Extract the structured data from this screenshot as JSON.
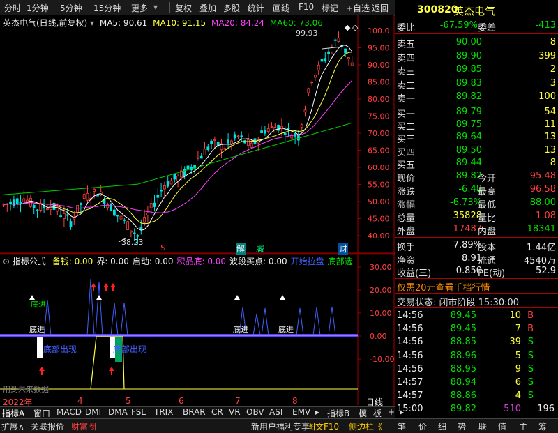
{
  "toolbar": {
    "periods": [
      "分时",
      "1分钟",
      "5分钟",
      "15分钟",
      "更多"
    ],
    "actions": [
      "复权",
      "叠加",
      "多股",
      "统计",
      "画线",
      "F10",
      "标记",
      "+自选",
      "返回"
    ]
  },
  "stock": {
    "code": "300820",
    "name": "英杰电气"
  },
  "chart_header": {
    "title": "英杰电气(日线,前复权)",
    "ma5": "MA5: 90.61",
    "ma10": "MA10: 91.15",
    "ma20": "MA20: 84.24",
    "ma60": "MA60: 73.06"
  },
  "price_axis": [
    "100.0",
    "95.00",
    "90.00",
    "85.00",
    "80.00",
    "75.00",
    "70.00",
    "65.00",
    "60.00",
    "55.00",
    "50.00",
    "45.00",
    "40.00"
  ],
  "price_annotations": {
    "high": "99.93",
    "low": "38.23"
  },
  "event_markers": [
    "$",
    "解",
    "减",
    "财"
  ],
  "indicator_header": {
    "name": "指标公式",
    "items": [
      {
        "text": "备钱: 0.00",
        "color": "#ffff40"
      },
      {
        "text": "界: 0.00",
        "color": "#eeeeee"
      },
      {
        "text": "启动: 0.00",
        "color": "#eeeeee"
      },
      {
        "text": "积品底: 0.00",
        "color": "#ff40ff"
      },
      {
        "text": "波段买点: 0.00",
        "color": "#eeeeee"
      },
      {
        "text": "开始拉盘",
        "color": "#4060ff"
      },
      {
        "text": "底部选",
        "color": "#00e000"
      }
    ]
  },
  "indicator_axis": [
    "30.00",
    "20.00",
    "10.00",
    "0.00",
    "-10.00"
  ],
  "indicator_labels": {
    "zhangjin": "底进",
    "bottom_appear": "底部出现",
    "future_data": "用到未来数据"
  },
  "time_axis": {
    "year": "2022年",
    "months": [
      "4",
      "5",
      "6",
      "7",
      "8"
    ],
    "period": "日线"
  },
  "bottom_tabs": [
    "指标A",
    "窗口",
    "MACD",
    "DMI",
    "DMA",
    "FSL",
    "TRIX",
    "BRAR",
    "CR",
    "VR",
    "OBV",
    "ASI",
    "EMV",
    "▸",
    "指标B",
    "模",
    "板",
    "+",
    "▸"
  ],
  "bottom_bar": [
    "扩展∧",
    "关联报价",
    "财富圈",
    "新用户福利专享",
    "图文F10",
    "侧边栏《",
    "笔",
    "价",
    "细",
    "势",
    "联",
    "值",
    "主",
    "筹"
  ],
  "quote": {
    "weibi": {
      "label": "委比",
      "value": "-67.59%"
    },
    "weicha": {
      "label": "委差",
      "value": "-413"
    },
    "asks": [
      {
        "label": "卖五",
        "price": "90.00",
        "vol": "8"
      },
      {
        "label": "卖四",
        "price": "89.90",
        "vol": "399"
      },
      {
        "label": "卖三",
        "price": "89.85",
        "vol": "2"
      },
      {
        "label": "卖二",
        "price": "89.83",
        "vol": "3"
      },
      {
        "label": "卖一",
        "price": "89.82",
        "vol": "100"
      }
    ],
    "bids": [
      {
        "label": "买一",
        "price": "89.79",
        "vol": "54"
      },
      {
        "label": "买二",
        "price": "89.75",
        "vol": "11"
      },
      {
        "label": "买三",
        "price": "89.64",
        "vol": "13"
      },
      {
        "label": "买四",
        "price": "89.50",
        "vol": "13"
      },
      {
        "label": "买五",
        "price": "89.44",
        "vol": "8"
      }
    ],
    "stats": [
      {
        "l1": "现价",
        "v1": "89.82",
        "c1": "green",
        "l2": "今开",
        "v2": "95.48",
        "c2": "red"
      },
      {
        "l1": "涨跌",
        "v1": "-6.48",
        "c1": "green",
        "l2": "最高",
        "v2": "96.58",
        "c2": "red"
      },
      {
        "l1": "涨幅",
        "v1": "-6.73%",
        "c1": "green",
        "l2": "最低",
        "v2": "88.00",
        "c2": "green"
      },
      {
        "l1": "总量",
        "v1": "35828",
        "c1": "yellow",
        "l2": "量比",
        "v2": "1.08",
        "c2": "red"
      },
      {
        "l1": "外盘",
        "v1": "17487",
        "c1": "red",
        "l2": "内盘",
        "v2": "18341",
        "c2": "green"
      }
    ],
    "stats2": [
      {
        "l1": "换手",
        "v1": "7.89%",
        "l2": "股本",
        "v2": "1.44亿"
      },
      {
        "l1": "净资",
        "v1": "8.91",
        "l2": "流通",
        "v2": "4540万"
      },
      {
        "l1": "收益(三)",
        "v1": "0.850",
        "l2": "PE(动)",
        "v2": "52.9"
      }
    ],
    "promo": "仅需20元查看千档行情",
    "trade_status": "交易状态: 闭市阶段 15:30:00",
    "ticks": [
      {
        "t": "14:56",
        "p": "89.45",
        "v": "10",
        "d": "B"
      },
      {
        "t": "14:56",
        "p": "89.45",
        "v": "7",
        "d": "B"
      },
      {
        "t": "14:56",
        "p": "88.85",
        "v": "39",
        "d": "S"
      },
      {
        "t": "14:56",
        "p": "88.96",
        "v": "5",
        "d": "S"
      },
      {
        "t": "14:56",
        "p": "88.95",
        "v": "9",
        "d": "S"
      },
      {
        "t": "14:57",
        "p": "88.94",
        "v": "6",
        "d": "S"
      },
      {
        "t": "14:57",
        "p": "88.86",
        "v": "4",
        "d": "S"
      },
      {
        "t": "15:00",
        "p": "89.82",
        "v": "510",
        "d": "196"
      }
    ]
  },
  "colors": {
    "up": "#ff4040",
    "down": "#00e000",
    "ma5": "#ffffff",
    "ma10": "#ffff40",
    "ma20": "#ff40ff",
    "ma60": "#00d000",
    "axis": "#a00000"
  }
}
